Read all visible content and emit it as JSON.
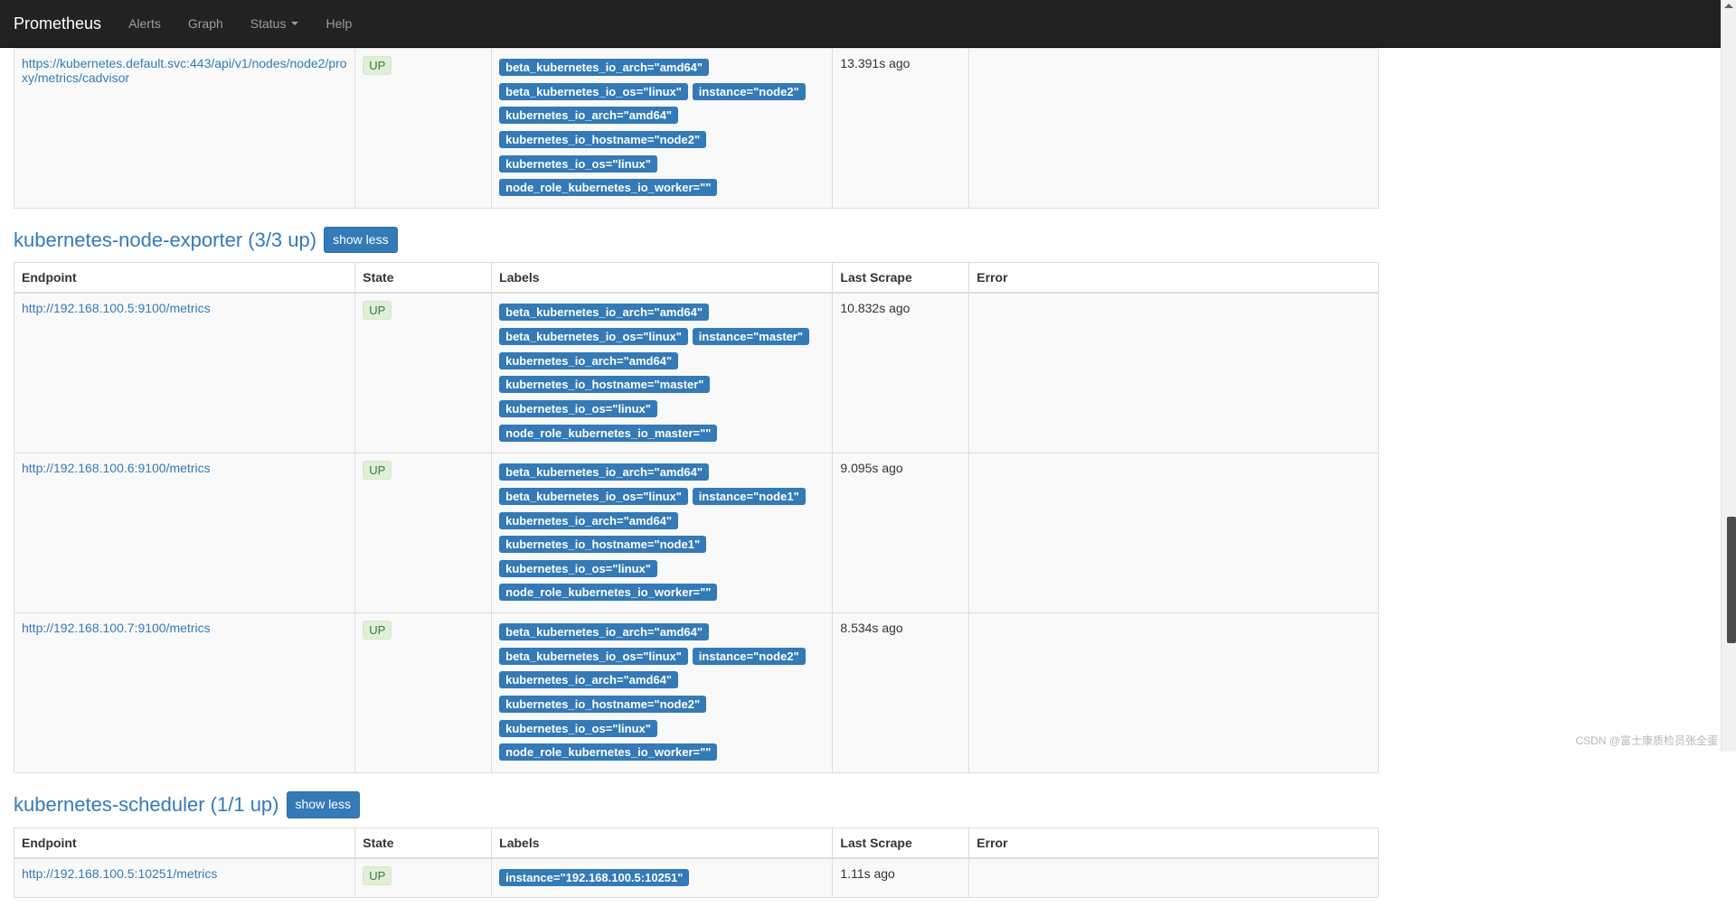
{
  "navbar": {
    "brand": "Prometheus",
    "items": [
      "Alerts",
      "Graph",
      "Status",
      "Help"
    ],
    "dropdown_index": 2
  },
  "columns": {
    "endpoint": "Endpoint",
    "state": "State",
    "labels": "Labels",
    "last_scrape": "Last Scrape",
    "error": "Error"
  },
  "show_less_label": "show less",
  "sections": [
    {
      "id": "kubernetes-cadvisor",
      "title_visible": false,
      "targets": [
        {
          "endpoint": "https://kubernetes.default.svc:443/api/v1/nodes/node2/proxy/metrics/cadvisor",
          "state": "UP",
          "labels": [
            "beta_kubernetes_io_arch=\"amd64\"",
            "beta_kubernetes_io_os=\"linux\"",
            "instance=\"node2\"",
            "kubernetes_io_arch=\"amd64\"",
            "kubernetes_io_hostname=\"node2\"",
            "kubernetes_io_os=\"linux\"",
            "node_role_kubernetes_io_worker=\"\""
          ],
          "last_scrape": "13.391s ago",
          "error": ""
        }
      ]
    },
    {
      "id": "kubernetes-node-exporter",
      "title": "kubernetes-node-exporter (3/3 up)",
      "title_visible": true,
      "targets": [
        {
          "endpoint": "http://192.168.100.5:9100/metrics",
          "state": "UP",
          "labels": [
            "beta_kubernetes_io_arch=\"amd64\"",
            "beta_kubernetes_io_os=\"linux\"",
            "instance=\"master\"",
            "kubernetes_io_arch=\"amd64\"",
            "kubernetes_io_hostname=\"master\"",
            "kubernetes_io_os=\"linux\"",
            "node_role_kubernetes_io_master=\"\""
          ],
          "last_scrape": "10.832s ago",
          "error": ""
        },
        {
          "endpoint": "http://192.168.100.6:9100/metrics",
          "state": "UP",
          "labels": [
            "beta_kubernetes_io_arch=\"amd64\"",
            "beta_kubernetes_io_os=\"linux\"",
            "instance=\"node1\"",
            "kubernetes_io_arch=\"amd64\"",
            "kubernetes_io_hostname=\"node1\"",
            "kubernetes_io_os=\"linux\"",
            "node_role_kubernetes_io_worker=\"\""
          ],
          "last_scrape": "9.095s ago",
          "error": ""
        },
        {
          "endpoint": "http://192.168.100.7:9100/metrics",
          "state": "UP",
          "labels": [
            "beta_kubernetes_io_arch=\"amd64\"",
            "beta_kubernetes_io_os=\"linux\"",
            "instance=\"node2\"",
            "kubernetes_io_arch=\"amd64\"",
            "kubernetes_io_hostname=\"node2\"",
            "kubernetes_io_os=\"linux\"",
            "node_role_kubernetes_io_worker=\"\""
          ],
          "last_scrape": "8.534s ago",
          "error": ""
        }
      ]
    },
    {
      "id": "kubernetes-scheduler",
      "title": "kubernetes-scheduler (1/1 up)",
      "title_visible": true,
      "targets": [
        {
          "endpoint": "http://192.168.100.5:10251/metrics",
          "state": "UP",
          "labels": [
            "instance=\"192.168.100.5:10251\""
          ],
          "last_scrape": "1.11s ago",
          "error": ""
        }
      ]
    }
  ],
  "watermark": "CSDN @富士康质检员张全蛋"
}
